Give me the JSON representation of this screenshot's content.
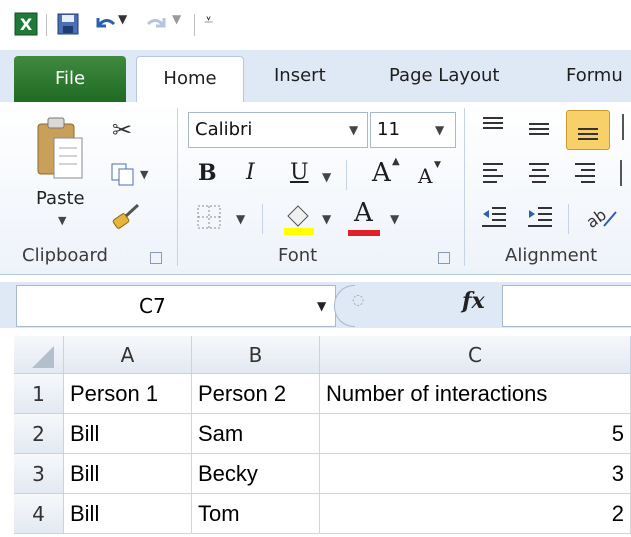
{
  "tabs": {
    "file": "File",
    "home": "Home",
    "insert": "Insert",
    "page_layout": "Page Layout",
    "formulas": "Formu"
  },
  "ribbon": {
    "clipboard": {
      "label": "Clipboard",
      "paste": "Paste"
    },
    "font": {
      "label": "Font",
      "name": "Calibri",
      "size": "11",
      "bold": "B",
      "italic": "I",
      "underline": "U",
      "grow": "A",
      "shrink": "A",
      "font_color": "A"
    },
    "alignment": {
      "label": "Alignment"
    }
  },
  "formula_bar": {
    "name_box": "C7",
    "fx": "fx",
    "value": ""
  },
  "sheet": {
    "columns": [
      "A",
      "B",
      "C"
    ],
    "rows": [
      {
        "num": "1",
        "a": "Person 1",
        "b": "Person 2",
        "c": "Number of interactions"
      },
      {
        "num": "2",
        "a": "Bill",
        "b": "Sam",
        "c": "5"
      },
      {
        "num": "3",
        "a": "Bill",
        "b": "Becky",
        "c": "3"
      },
      {
        "num": "4",
        "a": "Bill",
        "b": "Tom",
        "c": "2"
      }
    ]
  },
  "colors": {
    "file_tab": "#2a7a2e",
    "ribbon_bg": "#dfe9f5",
    "selected_button": "#f7d06a"
  }
}
